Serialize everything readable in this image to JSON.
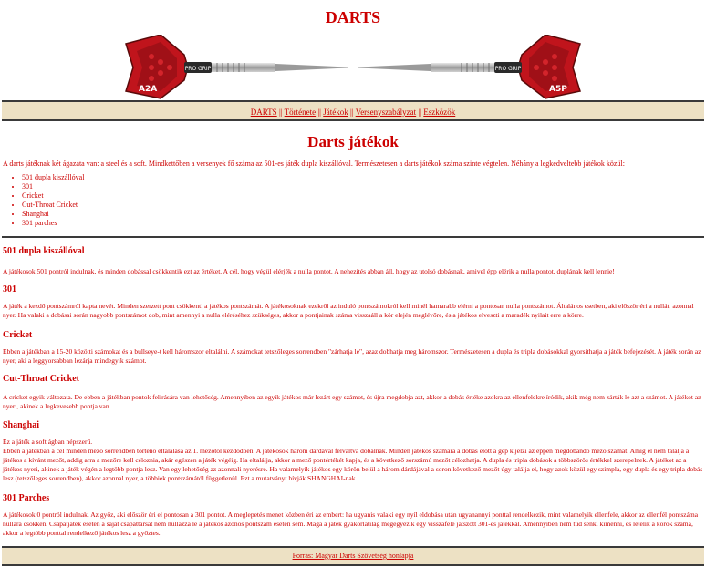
{
  "site": {
    "title": "DARTS"
  },
  "nav": {
    "items": [
      {
        "label": "DARTS"
      },
      {
        "label": "Története"
      },
      {
        "label": "Játékok"
      },
      {
        "label": "Versenyszabályzat"
      },
      {
        "label": "Eszközök"
      }
    ],
    "separator": "||"
  },
  "banner": {
    "left_dart_text": "A2A",
    "left_barrel_text": "PRO GRIP",
    "right_dart_text": "A5P",
    "right_barrel_text": "PRO GRIP",
    "colors": {
      "flight_red": "#c0141c",
      "flight_dark": "#5a0a0a",
      "barrel": "#b8b8b8"
    }
  },
  "main": {
    "heading": "Darts játékok",
    "intro": "A darts játéknak két ágazata van: a steel és a soft. Mindkettőben a versenyek fő száma az 501-es játék dupla kiszállóval. Természetesen a darts játékok száma szinte végtelen. Néhány a legkedveltebb játékok közül:",
    "games": [
      "501 dupla kiszállóval",
      "301",
      "Cricket",
      "Cut-Throat Cricket",
      "Shanghai",
      "301 parches"
    ]
  },
  "sections": [
    {
      "title": "501 dupla kiszállóval",
      "text": "A játékosok 501 pontról indulnak, és minden dobással csökkentik ezt az értéket. A cél, hogy végül elérjék a nulla pontot. A nehezítés abban áll, hogy az utolsó dobásnak, amivel épp elérik a nulla pontot, duplának kell lennie!"
    },
    {
      "title": "301",
      "text": "A játék a kezdő pontszámról kapta nevét. Minden szerzett pont csökkenti a játékos pontszámát. A játékosoknak ezekről az induló pontszámokról kell minél hamarabb elérni a pontosan nulla pontszámot. Általános esetben, aki először éri a nullát, azonnal nyer. Ha valaki a dobásai során nagyobb pontszámot dob, mint amennyi a nulla eléréséhez szükséges, akkor a pontjainak száma visszaáll a kör elején meglévőre, és a játékos elveszti a maradék nyilait erre a körre."
    },
    {
      "title": "Cricket",
      "text": "Ebben a játékban a 15-20 közötti számokat és a bullseye-t kell háromszor eltalálni. A számokat tetszőleges sorrendben \"zárhatja le\", azaz dobhatja meg háromszor. Természetesen a dupla és tripla dobásokkal gyorsíthatja a játék befejezését. A játék során az nyer, aki a leggyorsabban lezárja mindegyik számot."
    },
    {
      "title": "Cut-Throat Cricket",
      "text": "A cricket egyik változata. De ebben a játékban pontok felírására van lehetőség. Amennyiben az egyik játékos már lezárt egy számot, és újra megdobja azt, akkor a dobás értéke azokra az ellenfelekre íródik, akik még nem zárták le azt a számot. A játékot az nyeri, akinek a legkevesebb pontja van."
    },
    {
      "title": "Shanghai",
      "text": "Ez a játék a soft ágban népszerű.\nEbben a játékban a cél minden mező sorrendben történő eltalálása az 1. mezőtől kezdődően. A játékosok három dárdával felváltva dobálnak. Minden játékos számára a dobás előtt a gép kijelzi az éppen megdobandó mező számát. Amíg el nem találja a játékos a kívánt mezőt, addig arra a mezőre kell céloznia, akár egészen a játék végéig. Ha eltalálja, akkor a mező pontértékét kapja, és a következő sorszámú mezőt célozhatja. A dupla és tripla dobások a többszörös értékkel szerepelnek. A játékot az a játékos nyeri, akinek a játék végén a legtöbb pontja lesz. Van egy lehetőség az azonnali nyerésre. Ha valamelyik játékos egy körön belül a három dárdájával a soron következő mezőt úgy találja el, hogy azok közül egy szimpla, egy dupla és egy tripla dobás lesz (tetszőleges sorrendben), akkor azonnal nyer, a többiek pontszámától függetlenül. Ezt a mutatványt hívják SHANGHAI-nak."
    },
    {
      "title": "301 Parches",
      "text": "A játékosok 0 pontról indulnak. Az győz, aki először éri el pontosan a 301 pontot. A meglepetés menet közben éri az embert: ha ugyanis valaki egy nyíl eldobása után ugyanannyi ponttal rendelkezik, mint valamelyik ellenfele, akkor az ellenfél pontszáma nullára csökken. Csapatjáték esetén a saját csapattársát nem nullázza le a játékos azonos pontszám esetén sem. Maga a játék gyakorlatilag megegyezik egy visszafelé játszott 301-es játékkal. Amennyiben nem tud senki kimenni, és letelik a körök száma, akkor a legtöbb ponttal rendelkező játékos lesz a győztes."
    }
  ],
  "footer": {
    "label": "Forrás: Magyar Darts Szövetség honlapja"
  }
}
